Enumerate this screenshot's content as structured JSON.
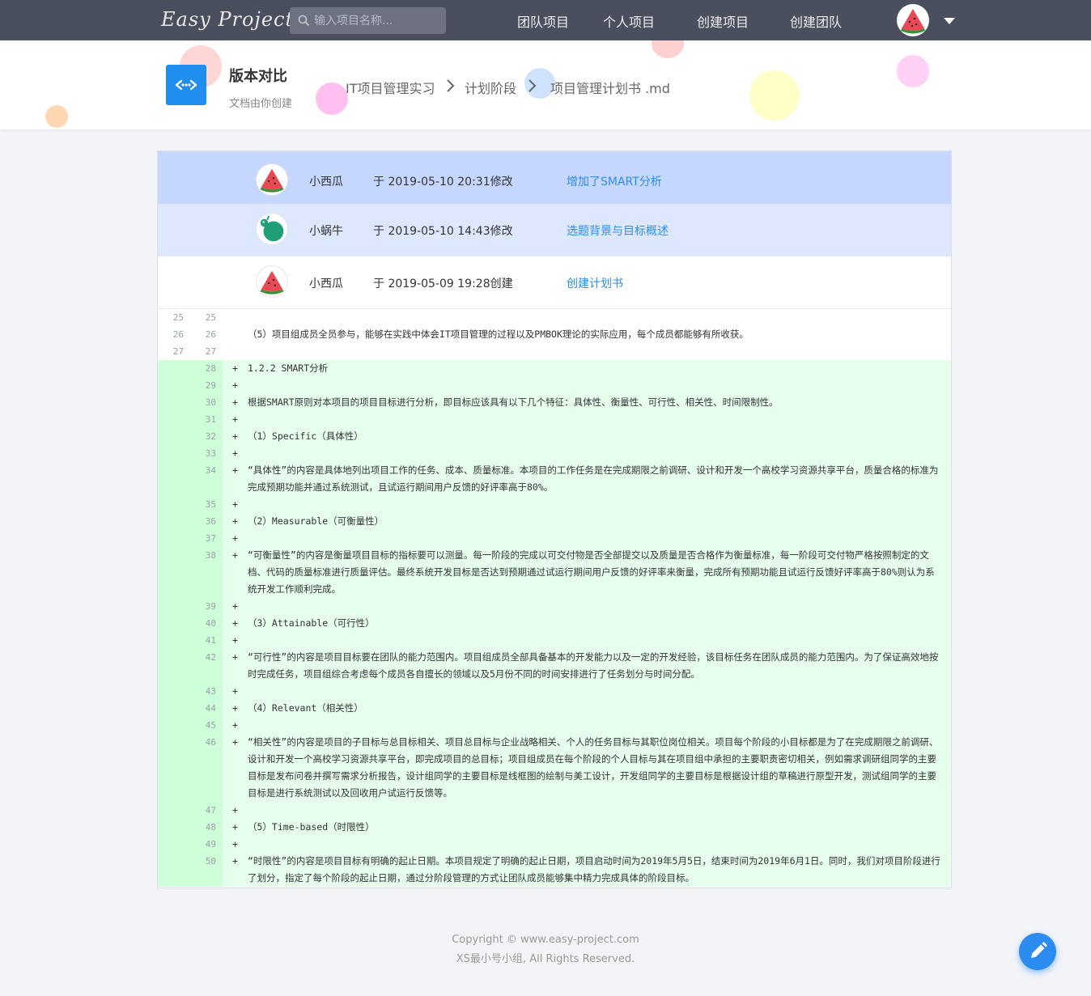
{
  "nav": {
    "logo": "Easy Project",
    "search_placeholder": "输入项目名称...",
    "links": [
      "团队项目",
      "个人项目",
      "创建项目",
      "创建团队"
    ]
  },
  "header": {
    "title": "版本对比",
    "subtitle": "文档由你创建",
    "breadcrumb": [
      "IT项目管理实习",
      "计划阶段",
      "项目管理计划书 .md"
    ]
  },
  "versions": [
    {
      "user": "小西瓜",
      "avatar": "watermelon-avatar",
      "time": "于 2019-05-10 20:31修改",
      "message": "增加了SMART分析",
      "state": "active"
    },
    {
      "user": "小蜗牛",
      "avatar": "snail-avatar",
      "time": "于 2019-05-10 14:43修改",
      "message": "选题背景与目标概述",
      "state": "compare"
    },
    {
      "user": "小西瓜",
      "avatar": "watermelon-avatar",
      "time": "于 2019-05-09 19:28创建",
      "message": "创建计划书",
      "state": "normal"
    }
  ],
  "diff": {
    "lines": [
      {
        "type": "ctx",
        "old": "25",
        "new": "25",
        "sign": "",
        "text": ""
      },
      {
        "type": "ctx",
        "old": "26",
        "new": "26",
        "sign": "",
        "text": "（5）项目组成员全员参与，能够在实践中体会IT项目管理的过程以及PMBOK理论的实际应用，每个成员都能够有所收获。"
      },
      {
        "type": "ctx",
        "old": "27",
        "new": "27",
        "sign": "",
        "text": ""
      },
      {
        "type": "add",
        "old": "",
        "new": "28",
        "sign": "+",
        "text": "1.2.2 SMART分析"
      },
      {
        "type": "add",
        "old": "",
        "new": "29",
        "sign": "+",
        "text": ""
      },
      {
        "type": "add",
        "old": "",
        "new": "30",
        "sign": "+",
        "text": "根据SMART原则对本项目的项目目标进行分析，即目标应该具有以下几个特征：具体性、衡量性、可行性、相关性、时间限制性。"
      },
      {
        "type": "add",
        "old": "",
        "new": "31",
        "sign": "+",
        "text": ""
      },
      {
        "type": "add",
        "old": "",
        "new": "32",
        "sign": "+",
        "text": "（1）Specific（具体性）"
      },
      {
        "type": "add",
        "old": "",
        "new": "33",
        "sign": "+",
        "text": ""
      },
      {
        "type": "add",
        "old": "",
        "new": "34",
        "sign": "+",
        "text": "“具体性”的内容是具体地列出项目工作的任务、成本、质量标准。本项目的工作任务是在完成期限之前调研、设计和开发一个高校学习资源共享平台，质量合格的标准为完成预期功能并通过系统测试，且试运行期间用户反馈的好评率高于80%。"
      },
      {
        "type": "add",
        "old": "",
        "new": "35",
        "sign": "+",
        "text": ""
      },
      {
        "type": "add",
        "old": "",
        "new": "36",
        "sign": "+",
        "text": "（2）Measurable（可衡量性）"
      },
      {
        "type": "add",
        "old": "",
        "new": "37",
        "sign": "+",
        "text": ""
      },
      {
        "type": "add",
        "old": "",
        "new": "38",
        "sign": "+",
        "text": "“可衡量性”的内容是衡量项目目标的指标要可以测量。每一阶段的完成以可交付物是否全部提交以及质量是否合格作为衡量标准，每一阶段可交付物严格按照制定的文档、代码的质量标准进行质量评估。最终系统开发目标是否达到预期通过试运行期间用户反馈的好评率来衡量，完成所有预期功能且试运行反馈好评率高于80%则认为系统开发工作顺利完成。"
      },
      {
        "type": "add",
        "old": "",
        "new": "39",
        "sign": "+",
        "text": ""
      },
      {
        "type": "add",
        "old": "",
        "new": "40",
        "sign": "+",
        "text": "（3）Attainable（可行性）"
      },
      {
        "type": "add",
        "old": "",
        "new": "41",
        "sign": "+",
        "text": ""
      },
      {
        "type": "add",
        "old": "",
        "new": "42",
        "sign": "+",
        "text": "“可行性”的内容是项目目标要在团队的能力范围内。项目组成员全部具备基本的开发能力以及一定的开发经验，该目标任务在团队成员的能力范围内。为了保证高效地按时完成任务，项目组综合考虑每个成员各自擅长的领域以及5月份不同的时间安排进行了任务划分与时间分配。"
      },
      {
        "type": "add",
        "old": "",
        "new": "43",
        "sign": "+",
        "text": ""
      },
      {
        "type": "add",
        "old": "",
        "new": "44",
        "sign": "+",
        "text": "（4）Relevant（相关性）"
      },
      {
        "type": "add",
        "old": "",
        "new": "45",
        "sign": "+",
        "text": ""
      },
      {
        "type": "add",
        "old": "",
        "new": "46",
        "sign": "+",
        "text": "“相关性”的内容是项目的子目标与总目标相关、项目总目标与企业战略相关、个人的任务目标与其职位岗位相关。项目每个阶段的小目标都是为了在完成期限之前调研、设计和开发一个高校学习资源共享平台，即完成项目的总目标；项目组成员在每个阶段的个人目标与其在项目组中承担的主要职责密切相关，例如需求调研组同学的主要目标是发布问卷并撰写需求分析报告，设计组同学的主要目标是线框图的绘制与美工设计，开发组同学的主要目标是根据设计组的草稿进行原型开发，测试组同学的主要目标是进行系统测试以及回收用户试运行反馈等。"
      },
      {
        "type": "add",
        "old": "",
        "new": "47",
        "sign": "+",
        "text": ""
      },
      {
        "type": "add",
        "old": "",
        "new": "48",
        "sign": "+",
        "text": "（5）Time-based（时限性）"
      },
      {
        "type": "add",
        "old": "",
        "new": "49",
        "sign": "+",
        "text": ""
      },
      {
        "type": "add",
        "old": "",
        "new": "50",
        "sign": "+",
        "text": "“时限性”的内容是项目目标有明确的起止日期。本项目规定了明确的起止日期，项目启动时间为2019年5月5日，结束时间为2019年6月1日。同时，我们对项目阶段进行了划分，指定了每个阶段的起止日期，通过分阶段管理的方式让团队成员能够集中精力完成具体的阶段目标。"
      }
    ]
  },
  "footer": {
    "line1": "Copyright © www.easy-project.com",
    "line2": "XS最小号小组, All Rights Reserved."
  },
  "colors": {
    "nav_bg": "#4a4f5e",
    "accent": "#2d8cf0",
    "active_row": "#c5d7ff",
    "compare_row": "#dde8ff",
    "add_bg": "#e6ffed",
    "add_gutter": "#cdffd8"
  }
}
